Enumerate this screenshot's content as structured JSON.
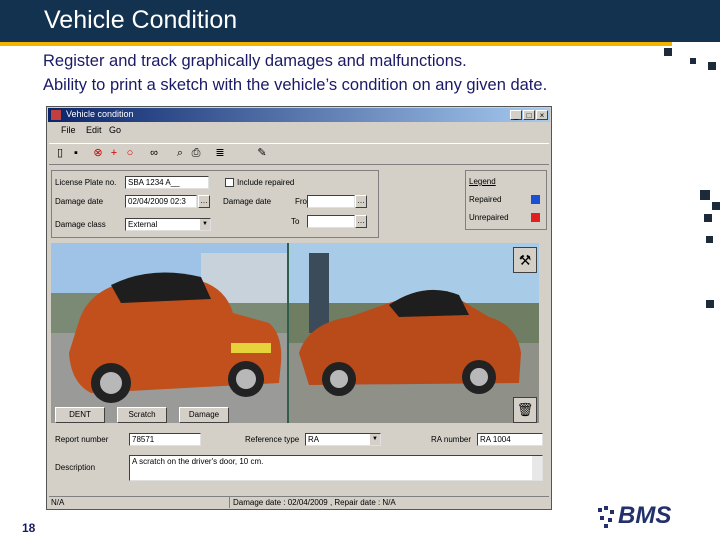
{
  "slide": {
    "title": "Vehicle Condition",
    "subtitle_line1": "Register and track graphically damages and malfunctions.",
    "subtitle_line2": "Ability to print a sketch with the vehicle’s condition on any given date.",
    "page_number": "18",
    "logo_text": "BMS",
    "colors": {
      "title_bg": "#12324f",
      "accent": "#f2b400",
      "text": "#1a1a66"
    }
  },
  "window": {
    "title": "Vehicle condition",
    "buttons": {
      "minimize": "_",
      "maximize": "□",
      "close": "×"
    },
    "menu": [
      "File",
      "Edit",
      "Go"
    ],
    "toolbar_icons": [
      "new-icon",
      "save-icon",
      "delete-icon",
      "add-icon",
      "circle-icon",
      "binoculars-icon",
      "zoom-icon",
      "print-preview-icon",
      "print-icon",
      "settings-icon"
    ]
  },
  "form": {
    "license_plate_label": "License Plate no.",
    "license_plate_value": "SBA 1234 A__",
    "include_repaired_label": "Include repaired",
    "damage_date_label": "Damage date",
    "damage_date_value": "02/04/2009 02:3",
    "damage_date_filter_label": "Damage date",
    "from_label": "From",
    "to_label": "To",
    "damage_class_label": "Damage class",
    "damage_class_value": "External",
    "legend_title": "Legend",
    "legend_repaired": "Repaired",
    "legend_unrepaired": "Unrepaired",
    "repaired_color": "#1a4fd6",
    "unrepaired_color": "#e02020"
  },
  "action_buttons": [
    "DENT",
    "Scratch",
    "Damage"
  ],
  "details": {
    "report_number_label": "Report number",
    "report_number_value": "78571",
    "reference_type_label": "Reference type",
    "reference_type_value": "RA",
    "ra_number_label": "RA number",
    "ra_number_value": "RA 1004",
    "description_label": "Description",
    "description_value": "A scratch on the driver's door, 10 cm."
  },
  "status": {
    "left": "N/A",
    "right": "Damage date : 02/04/2009 , Repair date : N/A"
  }
}
